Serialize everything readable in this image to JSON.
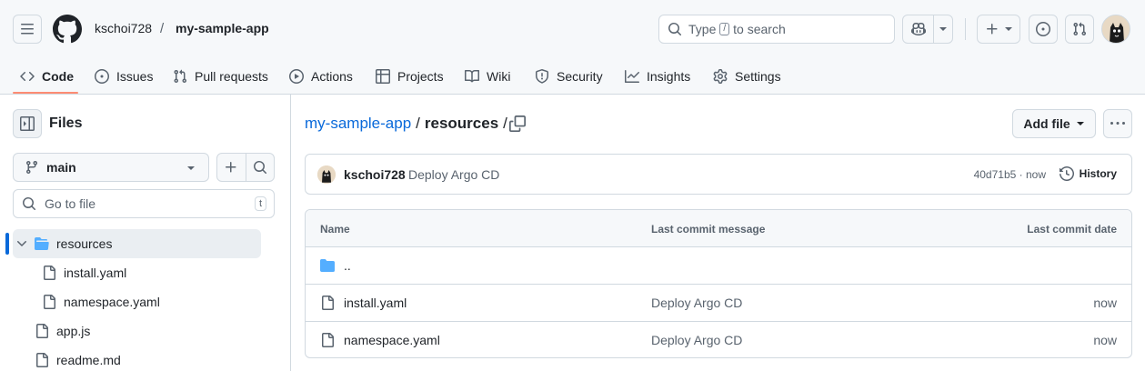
{
  "header": {
    "owner": "kschoi728",
    "separator": "/",
    "repo": "my-sample-app",
    "search": {
      "prefix": "Type",
      "key": "/",
      "suffix": "to search"
    }
  },
  "tabs": [
    {
      "label": "Code",
      "icon": "code-icon",
      "active": true
    },
    {
      "label": "Issues",
      "icon": "issue-opened-icon"
    },
    {
      "label": "Pull requests",
      "icon": "git-pull-request-icon"
    },
    {
      "label": "Actions",
      "icon": "play-icon"
    },
    {
      "label": "Projects",
      "icon": "table-icon"
    },
    {
      "label": "Wiki",
      "icon": "book-icon"
    },
    {
      "label": "Security",
      "icon": "shield-icon"
    },
    {
      "label": "Insights",
      "icon": "graph-icon"
    },
    {
      "label": "Settings",
      "icon": "gear-icon"
    }
  ],
  "sidebar": {
    "title": "Files",
    "branch": "main",
    "goto_placeholder": "Go to file",
    "goto_key": "t",
    "tree": [
      {
        "name": "resources",
        "type": "folder",
        "expanded": true,
        "selected": true
      },
      {
        "name": "install.yaml",
        "type": "file"
      },
      {
        "name": "namespace.yaml",
        "type": "file"
      },
      {
        "name": "app.js",
        "type": "file"
      },
      {
        "name": "readme.md",
        "type": "file"
      }
    ]
  },
  "main": {
    "path_repo": "my-sample-app",
    "path_sep": "/",
    "path_dir": "resources",
    "path_trailing": "/",
    "add_file_label": "Add file",
    "commit": {
      "author": "kschoi728",
      "message": "Deploy Argo CD",
      "sha": "40d71b5",
      "dot": "·",
      "time": "now",
      "history_label": "History"
    },
    "table": {
      "headers": {
        "name": "Name",
        "message": "Last commit message",
        "date": "Last commit date"
      },
      "parent": "..",
      "rows": [
        {
          "name": "install.yaml",
          "message": "Deploy Argo CD",
          "date": "now"
        },
        {
          "name": "namespace.yaml",
          "message": "Deploy Argo CD",
          "date": "now"
        }
      ]
    }
  },
  "colors": {
    "accent": "#0969da",
    "tab_underline": "#fd8c73",
    "folder": "#54aeff",
    "border": "#d1d9e0",
    "muted": "#59636e"
  }
}
